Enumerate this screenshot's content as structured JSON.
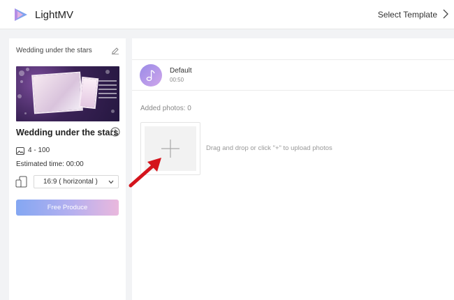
{
  "app": {
    "name": "LightMV",
    "select_template_label": "Select Template"
  },
  "sidebar": {
    "project_name": "Wedding under the stars",
    "template_title": "Wedding under the stars",
    "photos_range": "4 - 100",
    "estimated_time": "Estimated time: 00:00",
    "ratio_value": "16:9 ( horizontal )",
    "produce_label": "Free Produce"
  },
  "main": {
    "music": {
      "name": "Default",
      "duration": "00:50"
    },
    "added_photos_label": "Added photos: 0",
    "upload_hint": "Drag and drop or click \"+\" to upload photos"
  },
  "colors": {
    "accent_gradient_start": "#84a7f2",
    "accent_gradient_end": "#eab8dd",
    "arrow": "#d4141c",
    "music_gradient": "#9a8be8"
  },
  "icons": [
    "lightmv-logo-icon",
    "chevron-right-icon",
    "edit-icon",
    "info-icon",
    "photos-icon",
    "device-icon",
    "chevron-down-icon",
    "music-note-icon",
    "plus-icon",
    "red-arrow-annotation"
  ]
}
